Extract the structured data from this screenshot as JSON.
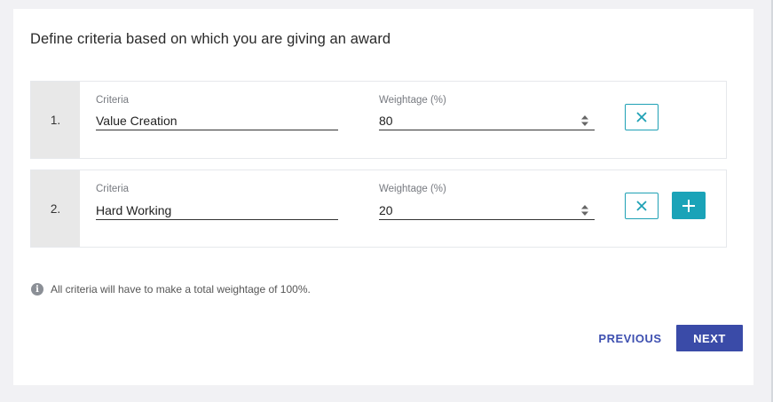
{
  "form": {
    "title": "Define criteria based on which you are giving an award",
    "rows": [
      {
        "number": "1.",
        "criteria_label": "Criteria",
        "criteria_value": "Value Creation",
        "weightage_label": "Weightage (%)",
        "weightage_value": "80"
      },
      {
        "number": "2.",
        "criteria_label": "Criteria",
        "criteria_value": "Hard Working",
        "weightage_label": "Weightage (%)",
        "weightage_value": "20"
      }
    ],
    "info_icon": "info-icon",
    "info_text": "All criteria will have to make a total weightage of 100%.",
    "previous_label": "PREVIOUS",
    "next_label": "NEXT"
  },
  "colors": {
    "accent_teal": "#1aa3b8",
    "primary_blue": "#3a4ba8",
    "link_blue": "#3d4fb0"
  }
}
